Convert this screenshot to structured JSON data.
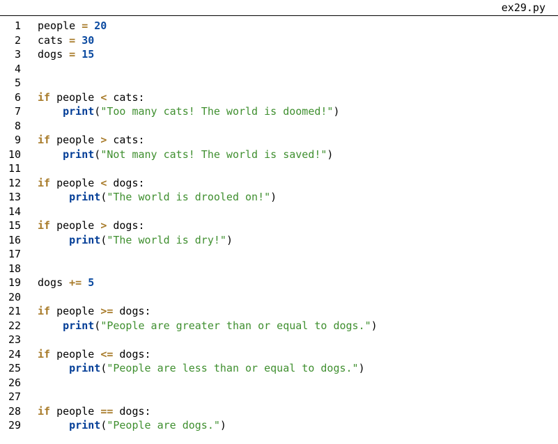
{
  "filename": "ex29.py",
  "lines": [
    {
      "n": 1,
      "tokens": [
        {
          "t": "name",
          "v": "people "
        },
        {
          "t": "op",
          "v": "="
        },
        {
          "t": "name",
          "v": " "
        },
        {
          "t": "num",
          "v": "20"
        }
      ]
    },
    {
      "n": 2,
      "tokens": [
        {
          "t": "name",
          "v": "cats "
        },
        {
          "t": "op",
          "v": "="
        },
        {
          "t": "name",
          "v": " "
        },
        {
          "t": "num",
          "v": "30"
        }
      ]
    },
    {
      "n": 3,
      "tokens": [
        {
          "t": "name",
          "v": "dogs "
        },
        {
          "t": "op",
          "v": "="
        },
        {
          "t": "name",
          "v": " "
        },
        {
          "t": "num",
          "v": "15"
        }
      ]
    },
    {
      "n": 4,
      "tokens": []
    },
    {
      "n": 5,
      "tokens": []
    },
    {
      "n": 6,
      "tokens": [
        {
          "t": "kw",
          "v": "if"
        },
        {
          "t": "name",
          "v": " people "
        },
        {
          "t": "op",
          "v": "<"
        },
        {
          "t": "name",
          "v": " cats"
        },
        {
          "t": "colon",
          "v": ":"
        }
      ]
    },
    {
      "n": 7,
      "tokens": [
        {
          "t": "indent",
          "v": "    "
        },
        {
          "t": "fn",
          "v": "print"
        },
        {
          "t": "paren",
          "v": "("
        },
        {
          "t": "str",
          "v": "\"Too many cats! The world is doomed!\""
        },
        {
          "t": "paren",
          "v": ")"
        }
      ]
    },
    {
      "n": 8,
      "tokens": []
    },
    {
      "n": 9,
      "tokens": [
        {
          "t": "kw",
          "v": "if"
        },
        {
          "t": "name",
          "v": " people "
        },
        {
          "t": "op",
          "v": ">"
        },
        {
          "t": "name",
          "v": " cats"
        },
        {
          "t": "colon",
          "v": ":"
        }
      ]
    },
    {
      "n": 10,
      "tokens": [
        {
          "t": "indent",
          "v": "    "
        },
        {
          "t": "fn",
          "v": "print"
        },
        {
          "t": "paren",
          "v": "("
        },
        {
          "t": "str",
          "v": "\"Not many cats! The world is saved!\""
        },
        {
          "t": "paren",
          "v": ")"
        }
      ]
    },
    {
      "n": 11,
      "tokens": []
    },
    {
      "n": 12,
      "tokens": [
        {
          "t": "kw",
          "v": "if"
        },
        {
          "t": "name",
          "v": " people "
        },
        {
          "t": "op",
          "v": "<"
        },
        {
          "t": "name",
          "v": " dogs"
        },
        {
          "t": "colon",
          "v": ":"
        }
      ]
    },
    {
      "n": 13,
      "tokens": [
        {
          "t": "indent",
          "v": "     "
        },
        {
          "t": "fn",
          "v": "print"
        },
        {
          "t": "paren",
          "v": "("
        },
        {
          "t": "str",
          "v": "\"The world is drooled on!\""
        },
        {
          "t": "paren",
          "v": ")"
        }
      ]
    },
    {
      "n": 14,
      "tokens": []
    },
    {
      "n": 15,
      "tokens": [
        {
          "t": "kw",
          "v": "if"
        },
        {
          "t": "name",
          "v": " people "
        },
        {
          "t": "op",
          "v": ">"
        },
        {
          "t": "name",
          "v": " dogs"
        },
        {
          "t": "colon",
          "v": ":"
        }
      ]
    },
    {
      "n": 16,
      "tokens": [
        {
          "t": "indent",
          "v": "     "
        },
        {
          "t": "fn",
          "v": "print"
        },
        {
          "t": "paren",
          "v": "("
        },
        {
          "t": "str",
          "v": "\"The world is dry!\""
        },
        {
          "t": "paren",
          "v": ")"
        }
      ]
    },
    {
      "n": 17,
      "tokens": []
    },
    {
      "n": 18,
      "tokens": []
    },
    {
      "n": 19,
      "tokens": [
        {
          "t": "name",
          "v": "dogs "
        },
        {
          "t": "op",
          "v": "+="
        },
        {
          "t": "name",
          "v": " "
        },
        {
          "t": "num",
          "v": "5"
        }
      ]
    },
    {
      "n": 20,
      "tokens": []
    },
    {
      "n": 21,
      "tokens": [
        {
          "t": "kw",
          "v": "if"
        },
        {
          "t": "name",
          "v": " people "
        },
        {
          "t": "op",
          "v": ">="
        },
        {
          "t": "name",
          "v": " dogs"
        },
        {
          "t": "colon",
          "v": ":"
        }
      ]
    },
    {
      "n": 22,
      "tokens": [
        {
          "t": "indent",
          "v": "    "
        },
        {
          "t": "fn",
          "v": "print"
        },
        {
          "t": "paren",
          "v": "("
        },
        {
          "t": "str",
          "v": "\"People are greater than or equal to dogs.\""
        },
        {
          "t": "paren",
          "v": ")"
        }
      ]
    },
    {
      "n": 23,
      "tokens": []
    },
    {
      "n": 24,
      "tokens": [
        {
          "t": "kw",
          "v": "if"
        },
        {
          "t": "name",
          "v": " people "
        },
        {
          "t": "op",
          "v": "<="
        },
        {
          "t": "name",
          "v": " dogs"
        },
        {
          "t": "colon",
          "v": ":"
        }
      ]
    },
    {
      "n": 25,
      "tokens": [
        {
          "t": "indent",
          "v": "     "
        },
        {
          "t": "fn",
          "v": "print"
        },
        {
          "t": "paren",
          "v": "("
        },
        {
          "t": "str",
          "v": "\"People are less than or equal to dogs.\""
        },
        {
          "t": "paren",
          "v": ")"
        }
      ]
    },
    {
      "n": 26,
      "tokens": []
    },
    {
      "n": 27,
      "tokens": []
    },
    {
      "n": 28,
      "tokens": [
        {
          "t": "kw",
          "v": "if"
        },
        {
          "t": "name",
          "v": " people "
        },
        {
          "t": "op",
          "v": "=="
        },
        {
          "t": "name",
          "v": " dogs"
        },
        {
          "t": "colon",
          "v": ":"
        }
      ]
    },
    {
      "n": 29,
      "tokens": [
        {
          "t": "indent",
          "v": "     "
        },
        {
          "t": "fn",
          "v": "print"
        },
        {
          "t": "paren",
          "v": "("
        },
        {
          "t": "str",
          "v": "\"People are dogs.\""
        },
        {
          "t": "paren",
          "v": ")"
        }
      ]
    }
  ]
}
